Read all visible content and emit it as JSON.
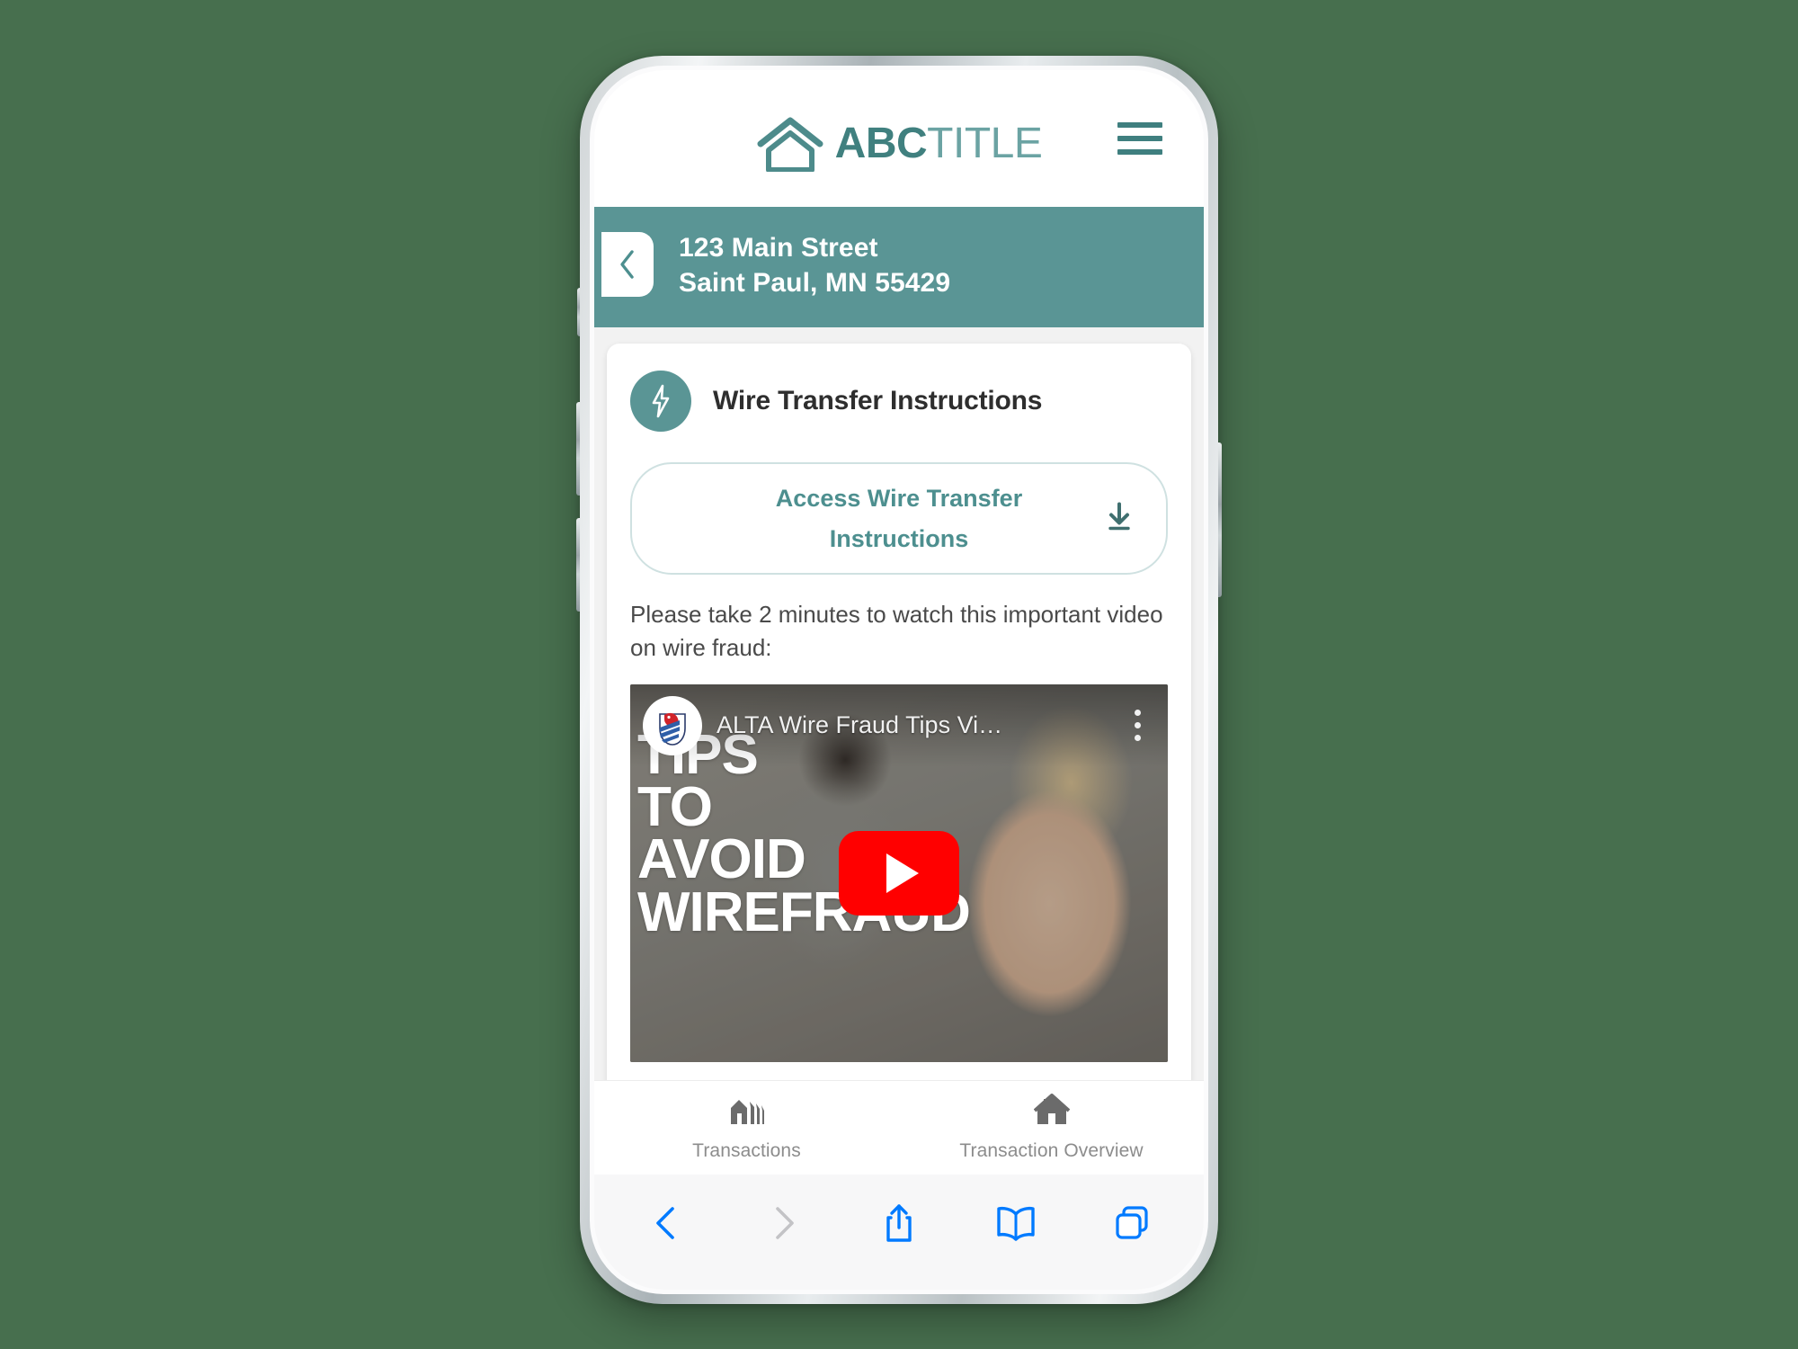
{
  "background_color": "#476F4E",
  "theme": {
    "teal": "#5a9595",
    "teal_dark": "#40807f",
    "teal_light": "#6ba3a3",
    "safari_blue": "#007aff"
  },
  "app_header": {
    "logo_icon": "house-outline-icon",
    "brand_bold": "ABC",
    "brand_light": "TITLE",
    "menu_icon": "hamburger-menu-icon"
  },
  "address_bar": {
    "back_icon": "chevron-left-icon",
    "line1": "123 Main Street",
    "line2": "Saint Paul, MN 55429"
  },
  "card": {
    "icon": "lightning-bolt-icon",
    "title": "Wire Transfer Instructions",
    "access_button": {
      "label": "Access Wire Transfer Instructions",
      "icon": "download-icon"
    },
    "note": "Please take 2 minutes to watch this important video on wire fraud:"
  },
  "video": {
    "channel_avatar": "alta-eagle-logo-icon",
    "title": "ALTA Wire Fraud Tips Vi…",
    "more_icon": "kebab-menu-icon",
    "play_icon": "youtube-play-icon",
    "thumbnail_line1": "TIPS",
    "thumbnail_line2": "TO",
    "thumbnail_line3": "AVOID",
    "thumbnail_line4": "WIREFRAUD"
  },
  "tabbar": {
    "tabs": [
      {
        "icon": "houses-icon",
        "label": "Transactions"
      },
      {
        "icon": "home-icon",
        "label": "Transaction Overview"
      }
    ]
  },
  "safari_toolbar": {
    "items": [
      {
        "icon": "back-chevron-icon",
        "state": "enabled"
      },
      {
        "icon": "forward-chevron-icon",
        "state": "disabled"
      },
      {
        "icon": "share-icon",
        "state": "enabled"
      },
      {
        "icon": "bookmarks-book-icon",
        "state": "enabled"
      },
      {
        "icon": "tabs-icon",
        "state": "enabled"
      }
    ]
  }
}
